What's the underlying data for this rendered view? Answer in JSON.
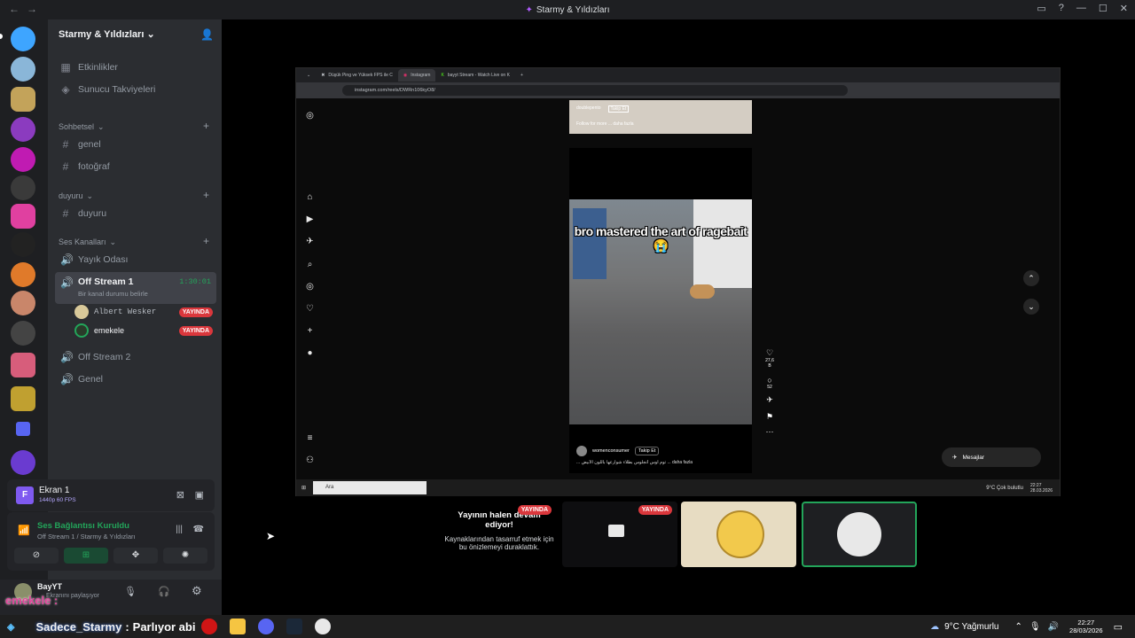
{
  "window": {
    "title": "Starmy & Yıldızları"
  },
  "guild": {
    "name": "Starmy & Yıldızları",
    "top_items": [
      {
        "label": "Etkinlikler",
        "icon": "calendar-icon"
      },
      {
        "label": "Sunucu Takviyeleri",
        "icon": "boost-icon"
      }
    ],
    "categories": {
      "sohbetsel": "Sohbetsel",
      "duyuru": "duyuru",
      "ses": "Ses Kanalları"
    },
    "text_channels": [
      "genel",
      "fotoğraf"
    ],
    "announce_channels": [
      "duyuru"
    ],
    "voice_channels": {
      "yayik": "Yayık Odası",
      "off1": "Off Stream 1",
      "off1_timer": "1:30:01",
      "off1_status": "Bir kanal durumu belirle",
      "off2": "Off Stream 2",
      "genel": "Genel"
    },
    "voice_users": [
      {
        "name": "Albert Wesker",
        "badge": "YAYINDA"
      },
      {
        "name": "emekele",
        "badge": "YAYINDA"
      }
    ]
  },
  "stream_panel": {
    "title": "Ekran 1",
    "quality": "1440p 60 FPS"
  },
  "voice_panel": {
    "status": "Ses Bağlantısı Kuruldu",
    "location": "Off Stream 1 / Starmy & Yıldızları"
  },
  "user_panel": {
    "name": "BayYT",
    "status": "Ekranını paylaşıyor"
  },
  "overlay": {
    "text": "emekele :"
  },
  "browser": {
    "tabs": [
      "Düşük Ping ve Yüksek FPS ile C",
      "Instagram",
      "bayyt Stream - Watch Live on K"
    ],
    "url": "instagram.com/reels/DWRn106kyO8/",
    "post_top_user": "doublepento",
    "post_top_follow": "Takip Et",
    "post_top_caption": "Follow for more ... daha fazla",
    "video_caption": "bro mastered the art of ragebait 😭",
    "video_user": "womenconsumer",
    "video_follow": "Takip Et",
    "video_desc": "... توم اوس أنجلوس بطلاء شوارعها باللون الأبيض ... daha fazla",
    "likes": "27,6 B",
    "comments": "52",
    "messages": "Mesajlar",
    "messages_badge": "6",
    "notif_badge": "2",
    "win_search": "Ara",
    "win_weather": "9°C Çok bulutlu",
    "win_time": "22:27",
    "win_date": "28.03.2026"
  },
  "tiles": {
    "paused_title": "Yayının halen devam ediyor!",
    "paused_desc": "Kaynaklarından tasarruf etmek için bu önizlemeyi duraklattık.",
    "live_badge_1": "YAYINDA",
    "live_badge_2": "YAYINDA"
  },
  "taskbar": {
    "ticker_name": "Sadece_Starmy",
    "ticker_text": "Parlıyor abi",
    "weather": "9°C Yağmurlu",
    "time": "22:27",
    "date": "28/03/2026"
  },
  "colors": {
    "discord_bg": "#2b2d31",
    "servers_bg": "#1e1f22",
    "live_red": "#da373c",
    "accent_green": "#23a55a"
  }
}
